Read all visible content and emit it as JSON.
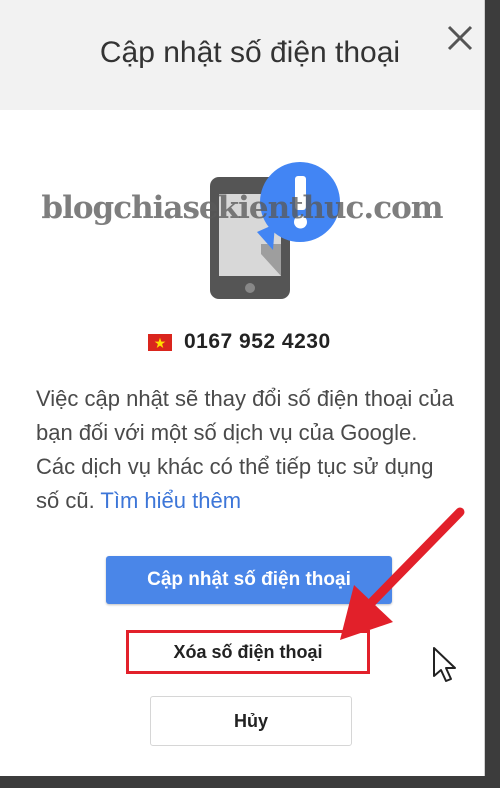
{
  "dialog": {
    "title": "Cập nhật số điện thoại",
    "close_icon": "close-icon",
    "watermark": "blogchiasekienthuc.com",
    "illustration_icon": "phone-alert-icon",
    "flag_icon": "vietnam-flag-icon",
    "phone_number": "0167 952 4230",
    "description": "Việc cập nhật sẽ thay đổi số điện thoại của bạn đối với một số dịch vụ của Google. Các dịch vụ khác có thể tiếp tục sử dụng số cũ.",
    "learn_more_link": "Tìm hiểu thêm",
    "update_button": "Cập nhật số điện thoại",
    "remove_button": "Xóa số điện thoại",
    "cancel_button": "Hủy"
  },
  "colors": {
    "primary_button": "#4a86e8",
    "annotation_red": "#e2202a",
    "link": "#3d76d8",
    "alert_blue": "#4285f4"
  }
}
